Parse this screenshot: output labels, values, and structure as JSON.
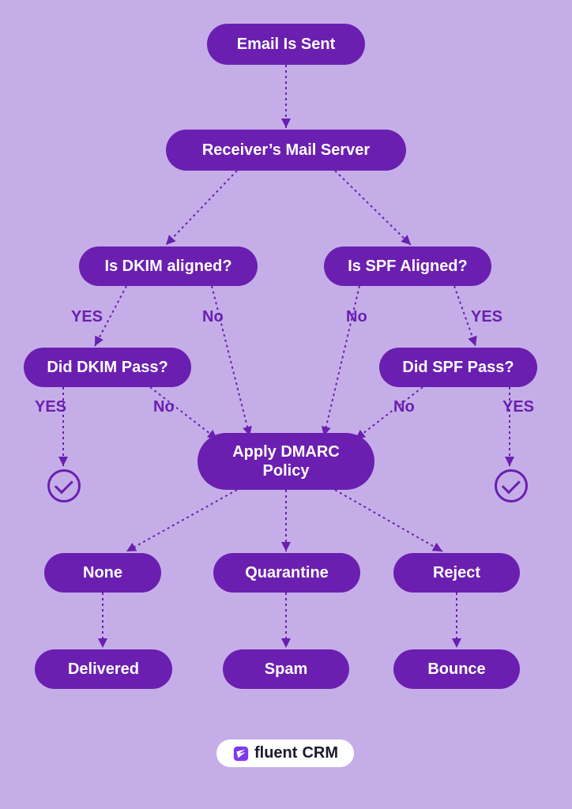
{
  "nodes": {
    "email_sent": "Email Is Sent",
    "receiver": "Receiver’s Mail Server",
    "dkim_aligned": "Is DKIM aligned?",
    "spf_aligned": "Is SPF Aligned?",
    "dkim_pass": "Did DKIM Pass?",
    "spf_pass": "Did SPF Pass?",
    "apply_dmarc": "Apply DMARC Policy",
    "none": "None",
    "quarantine": "Quarantine",
    "reject": "Reject",
    "delivered": "Delivered",
    "spam": "Spam",
    "bounce": "Bounce"
  },
  "labels": {
    "yes": "YES",
    "no": "No"
  },
  "brand": {
    "fluent": "fluent",
    "crm": "CRM"
  }
}
